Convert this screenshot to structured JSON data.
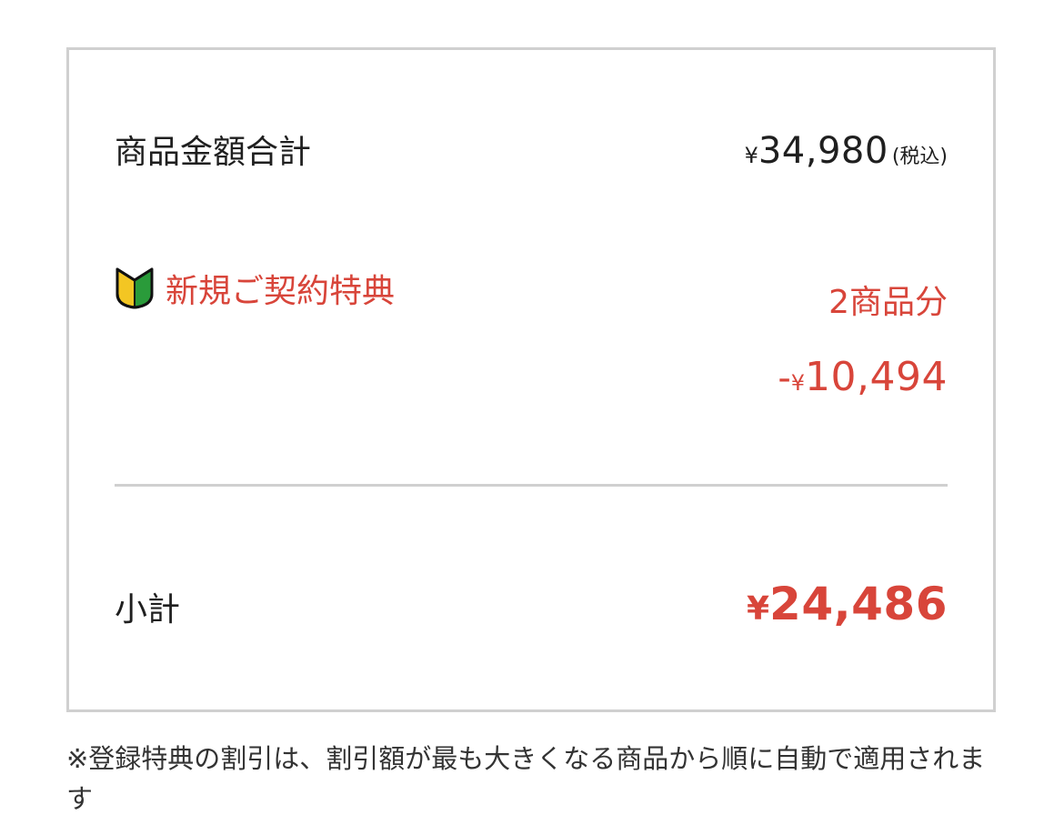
{
  "summary": {
    "product_total": {
      "label": "商品金額合計",
      "currency": "¥",
      "amount": "34,980",
      "tax_note": "(税込)"
    },
    "new_contract_benefit": {
      "icon": "beginner-mark-icon",
      "label": "新規ご契約特典",
      "quantity": "2商品分",
      "discount_prefix": "-",
      "currency": "¥",
      "discount_amount": "10,494"
    },
    "subtotal": {
      "label": "小計",
      "currency": "¥",
      "amount": "24,486"
    }
  },
  "note": "※登録特典の割引は、割引額が最も大きくなる商品から順に自動で適用されます",
  "colors": {
    "accent_red": "#d8453a",
    "border_gray": "#d0d0d0",
    "text_dark": "#1f1f1f",
    "badge_yellow": "#f3c623",
    "badge_green": "#2a9b3a"
  }
}
